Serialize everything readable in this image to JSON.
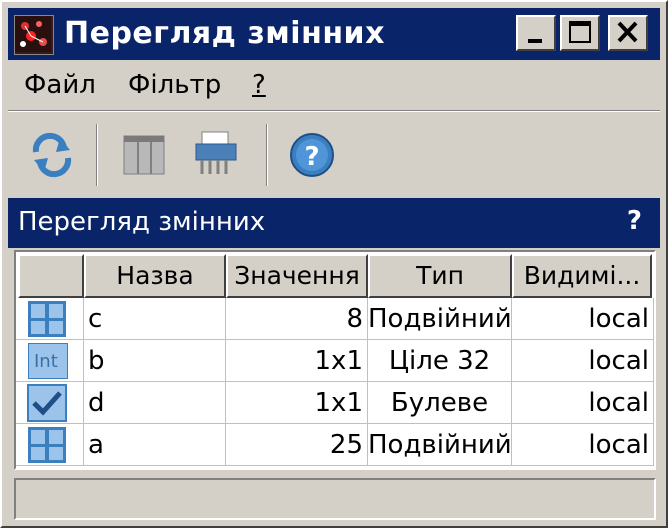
{
  "window": {
    "title": "Перегляд змінних",
    "minimize_icon": "minimize-icon",
    "maximize_icon": "maximize-icon",
    "close_icon": "close-icon"
  },
  "menu": {
    "items": [
      {
        "label": "Файл"
      },
      {
        "label": "Фільтр"
      },
      {
        "label": "?"
      }
    ]
  },
  "toolbar": {
    "buttons": [
      {
        "icon": "refresh-icon"
      },
      {
        "icon": "columns-icon"
      },
      {
        "icon": "shredder-icon"
      },
      {
        "icon": "help-icon"
      }
    ]
  },
  "panel": {
    "title": "Перегляд змінних",
    "help": "?"
  },
  "table": {
    "columns": [
      "",
      "Назва",
      "Значення",
      "Тип",
      "Видимі..."
    ],
    "rows": [
      {
        "icon": "grid-icon",
        "name": "c",
        "value": "8",
        "type": "Подвійний",
        "visibility": "local"
      },
      {
        "icon": "int-icon",
        "icon_text": "Int",
        "name": "b",
        "value": "1x1",
        "type": "Ціле 32",
        "visibility": "local"
      },
      {
        "icon": "checkmark-icon",
        "name": "d",
        "value": "1x1",
        "type": "Булеве",
        "visibility": "local"
      },
      {
        "icon": "grid-icon",
        "name": "a",
        "value": "25",
        "type": "Подвійний",
        "visibility": "local"
      }
    ]
  },
  "colors": {
    "titlebar": "#0a246a",
    "window_bg": "#d4d0c8",
    "icon_blue": "#3a7fc0"
  }
}
